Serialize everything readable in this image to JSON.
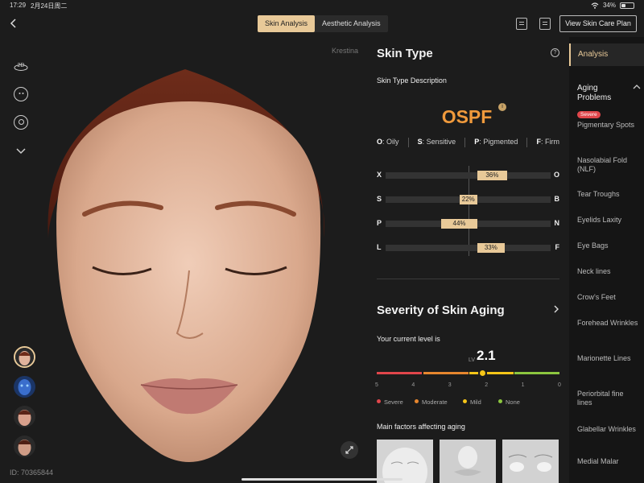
{
  "status": {
    "time": "17:29",
    "date": "2月24日周二",
    "battery": "34%",
    "battery_level": 0.34
  },
  "header": {
    "tabs": [
      {
        "label": "Skin Analysis",
        "active": true
      },
      {
        "label": "Aesthetic Analysis",
        "active": false
      }
    ],
    "plan_button": "View Skin Care Plan"
  },
  "viewer": {
    "owner": "Krestina",
    "patient_id": "ID: 70365844",
    "tools": [
      {
        "icon": "3d-view-icon",
        "label": "2D"
      },
      {
        "icon": "face-rotate-icon"
      },
      {
        "icon": "face-scan-icon"
      },
      {
        "icon": "chevron-down-icon"
      }
    ]
  },
  "skin_type": {
    "title": "Skin Type",
    "subtitle": "Skin Type Description",
    "code": "OSPF",
    "legend": [
      {
        "key": "O",
        "label": "Oily"
      },
      {
        "key": "S",
        "label": "Sensitive"
      },
      {
        "key": "P",
        "label": "Pigmented"
      },
      {
        "key": "F",
        "label": "Firm"
      }
    ],
    "scales": [
      {
        "left": "X",
        "right": "O",
        "value": "36%",
        "pct": 36,
        "side": "right"
      },
      {
        "left": "S",
        "right": "B",
        "value": "22%",
        "pct": 22,
        "side": "left"
      },
      {
        "left": "P",
        "right": "N",
        "value": "44%",
        "pct": 44,
        "side": "left"
      },
      {
        "left": "L",
        "right": "F",
        "value": "33%",
        "pct": 33,
        "side": "right"
      }
    ]
  },
  "severity": {
    "title": "Severity of Skin Aging",
    "current_label": "Your current level is",
    "lv_label": "LV",
    "level": "2.1",
    "level_value": 2.1,
    "ticks": [
      "5",
      "4",
      "3",
      "2",
      "1",
      "0"
    ],
    "legend": [
      {
        "label": "Severe",
        "color": "#e0464b"
      },
      {
        "label": "Moderate",
        "color": "#e6862e"
      },
      {
        "label": "Mild",
        "color": "#f5c518"
      },
      {
        "label": "None",
        "color": "#8cc63f"
      }
    ],
    "factors_title": "Main factors affecting aging"
  },
  "nav": {
    "active": "Analysis",
    "group": "Aging Problems",
    "severe_badge": "Severe",
    "items": [
      "Pigmentary Spots",
      "Nasolabial Fold (NLF)",
      "Tear Troughs",
      "Eyelids Laxity",
      "Eye Bags",
      "Neck lines",
      "Crow's Feet",
      "Forehead Wrinkles",
      "Marionette Lines",
      "Periorbital fine lines",
      "Glabellar Wrinkles",
      "Medial Malar"
    ]
  },
  "colors": {
    "accent": "#e8c998",
    "code": "#f09a3c"
  }
}
